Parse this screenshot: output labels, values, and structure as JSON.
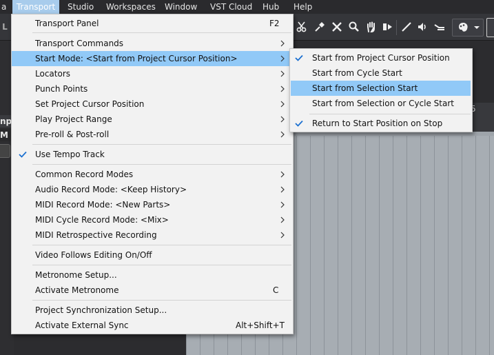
{
  "menubar": {
    "items": [
      "a",
      "Transport",
      "Studio",
      "Workspaces",
      "Window",
      "VST Cloud",
      "Hub",
      "Help"
    ]
  },
  "toolbar": {
    "left_label": "L",
    "tools": [
      "scissors-icon",
      "glue-icon",
      "mute-x-icon",
      "zoom-icon",
      "hand-icon",
      "play-tool-icon",
      "line-draw-icon",
      "speaker-icon",
      "time-warp-icon",
      "color-palette-icon"
    ]
  },
  "workspace": {
    "left_label": "npu",
    "left_m": "M",
    "ruler_number": "5"
  },
  "transport_menu": {
    "items": [
      {
        "label": "Transport Panel",
        "shortcut": "F2"
      },
      {
        "label": "Transport Commands",
        "submenu": true
      },
      {
        "label": "Start Mode: <Start from Project Cursor Position>",
        "submenu": true,
        "highlighted": true
      },
      {
        "label": "Locators",
        "submenu": true
      },
      {
        "label": "Punch Points",
        "submenu": true
      },
      {
        "label": "Set Project Cursor Position",
        "submenu": true
      },
      {
        "label": "Play Project Range",
        "submenu": true
      },
      {
        "label": "Pre-roll & Post-roll",
        "submenu": true
      },
      {
        "label": "Use Tempo Track",
        "checked": true
      },
      {
        "label": "Common Record Modes",
        "submenu": true
      },
      {
        "label": "Audio Record Mode: <Keep History>",
        "submenu": true
      },
      {
        "label": "MIDI Record Mode: <New Parts>",
        "submenu": true
      },
      {
        "label": "MIDI Cycle Record Mode: <Mix>",
        "submenu": true
      },
      {
        "label": "MIDI Retrospective Recording",
        "submenu": true
      },
      {
        "label": "Video Follows Editing On/Off"
      },
      {
        "label": "Metronome Setup..."
      },
      {
        "label": "Activate Metronome",
        "shortcut": "C"
      },
      {
        "label": "Project Synchronization Setup..."
      },
      {
        "label": "Activate External Sync",
        "shortcut": "Alt+Shift+T"
      }
    ]
  },
  "start_mode_submenu": {
    "items": [
      {
        "label": "Start from Project Cursor Position",
        "checked": true
      },
      {
        "label": "Start from Cycle Start"
      },
      {
        "label": "Start from Selection Start",
        "highlighted": true
      },
      {
        "label": "Start from Selection or Cycle Start"
      },
      {
        "label": "Return to Start Position on Stop",
        "checked": true
      }
    ]
  },
  "colors": {
    "highlight": "#91c9f7",
    "check": "#1a6fd0",
    "menu_bg": "#f2f2f2",
    "menubar_bg": "#2a2a2d"
  }
}
